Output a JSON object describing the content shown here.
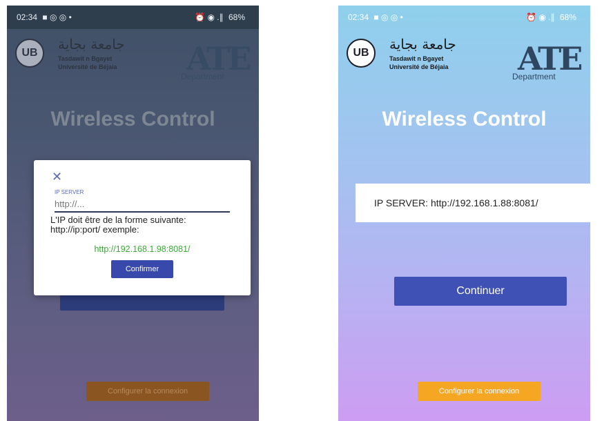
{
  "status_bar": {
    "time": "02:34",
    "left_icons": "■ ◎ ◎ •",
    "right_icons": "⏰ ◉ .∥",
    "battery": "68%"
  },
  "logo": {
    "seal_text": "UB",
    "arabic": "جامعة بجاية",
    "line1": "Tasdawit n Bgayet",
    "line2": "Université de Béjaia",
    "ate": "ATE",
    "department": "Department"
  },
  "app_title": "Wireless Control",
  "dialog": {
    "close_glyph": "✕",
    "label": "IP SERVER",
    "placeholder": "http://...",
    "info": "L'IP doit être de la forme suivante: http://ip:port/ exemple:",
    "example": "http://192.168.1.98:8081/",
    "confirm_label": "Confirmer"
  },
  "ip_display": "IP SERVER: http://192.168.1.88:8081/",
  "continue_label": "Continuer",
  "configure_label": "Configurer la connexion",
  "colors": {
    "primary": "#3f51b5",
    "accent": "#f5a623",
    "example_green": "#3aaa35"
  }
}
